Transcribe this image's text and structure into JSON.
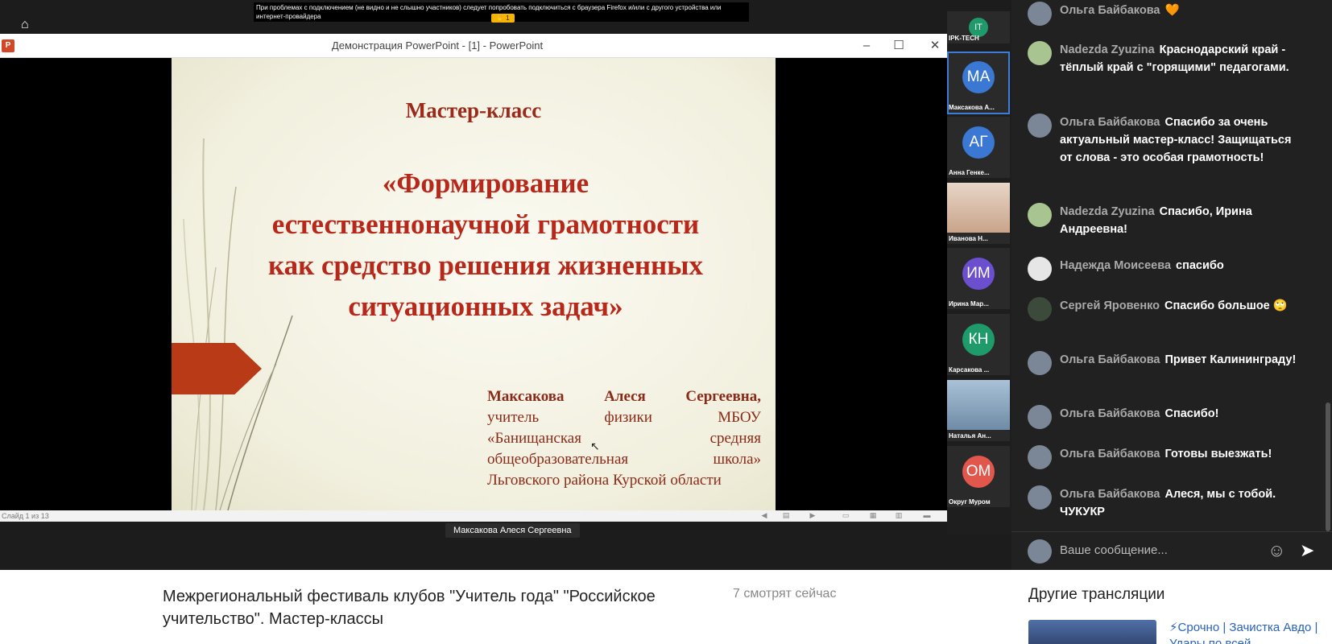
{
  "notice": {
    "text": "При проблемах с подключением (не видно и не слышно участников) следует попробовать подключиться с браузера Firefox и/или с другого устройства или интернет-провайдера",
    "raise_hand": "✋ 1"
  },
  "ppt": {
    "icon": "P",
    "title": "Демонстрация PowerPoint - [1] - PowerPoint",
    "status": "Слайд 1 из 13"
  },
  "slide": {
    "title": "Мастер-класс",
    "main_line1": "«Формирование",
    "main_line2": "естественнонаучной грамотности",
    "main_line3": "как средство решения жизненных",
    "main_line4": "ситуационных задач»",
    "author_name": "Максакова Алеся Сергеевна,",
    "author_line2": "учитель физики МБОУ",
    "author_line3": "«Банищанская средняя",
    "author_line4": "общеобразовательная школа»",
    "author_line5": "Льговского района Курской области"
  },
  "speaker_label": "Максакова Алеся Сергеевна",
  "participants": [
    {
      "initials": "IT",
      "name": "IPK-TECH",
      "color": "#1f9a6b"
    },
    {
      "initials": "МА",
      "name": "Максакова А...",
      "color": "#3a78d4"
    },
    {
      "initials": "АГ",
      "name": "Анна Генке...",
      "color": "#3a78d4"
    },
    {
      "initials": "",
      "name": "Иванова Н...",
      "color": "#c9a48a"
    },
    {
      "initials": "ИМ",
      "name": "Ирина Мар...",
      "color": "#6b4fcf"
    },
    {
      "initials": "КН",
      "name": "Карсакова ...",
      "color": "#1f9a6b"
    },
    {
      "initials": "",
      "name": "Наталья Ан...",
      "color": "#7fa2c0"
    },
    {
      "initials": "ОМ",
      "name": "Округ Муром",
      "color": "#e2574c"
    }
  ],
  "chat": {
    "messages": [
      {
        "author": "Ольга Байбакова",
        "text": "🧡"
      },
      {
        "author": "Nadezda Zyuzina",
        "text": "Краснодарский край - тёплый край с \"горящими\" педагогами."
      },
      {
        "author": "Ольга Байбакова",
        "text": "Спасибо за очень актуальный мастер-класс! Защищаться от слова - это особая грамотность!"
      },
      {
        "author": "Nadezda Zyuzina",
        "text": "Спасибо, Ирина Андреевна!"
      },
      {
        "author": "Надежда Моисеева",
        "text": "спасибо"
      },
      {
        "author": "Сергей Яровенко",
        "text": "Спасибо большое 🙄"
      },
      {
        "author": "Ольга Байбакова",
        "text": "Привет Калининграду!"
      },
      {
        "author": "Ольга Байбакова",
        "text": "Спасибо!"
      },
      {
        "author": "Ольга Байбакова",
        "text": "Готовы выезжать!"
      },
      {
        "author": "Ольга Байбакова",
        "text": "Алеся, мы с тобой. ЧУКУКР"
      }
    ],
    "input_placeholder": "Ваше сообщение...",
    "emoji_icon": "☺",
    "send_icon": "➤"
  },
  "stream": {
    "title": "Межрегиональный фестиваль клубов \"Учитель года\" \"Российское учительство\". Мастер-классы",
    "viewers": "7 смотрят сейчас"
  },
  "other": {
    "heading": "Другие трансляции",
    "link": "⚡Срочно | Зачистка Авдо | Удары по всей"
  },
  "colors": {
    "slide_title": "#9b2a1a",
    "slide_text": "#b8281a",
    "chat_bg": "#212121",
    "accent": "#3d7dd8"
  }
}
